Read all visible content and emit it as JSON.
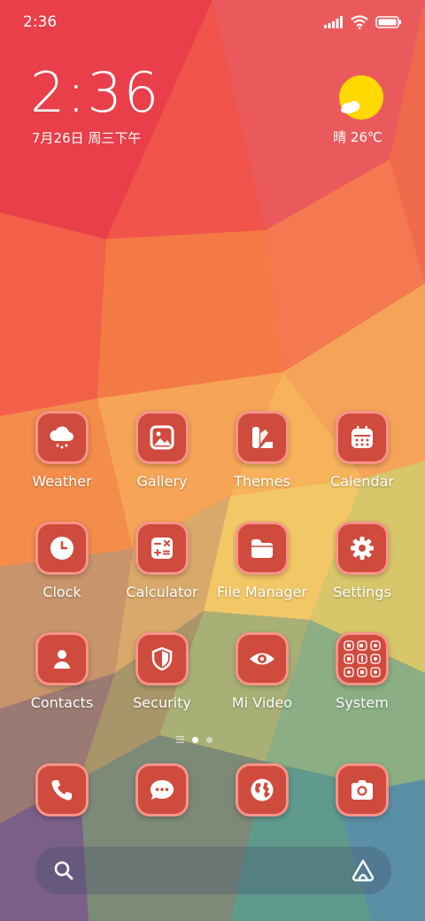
{
  "status_bar": {
    "time": "2:36",
    "icons": [
      "signal-icon",
      "wifi-icon",
      "battery-icon"
    ]
  },
  "clock_widget": {
    "time": "2:36",
    "date": "7月26日 周三下午"
  },
  "weather_widget": {
    "icon": "sun-cloud-icon",
    "text": "晴 26℃"
  },
  "apps": [
    {
      "label": "Weather",
      "icon": "cloud-snow-icon"
    },
    {
      "label": "Gallery",
      "icon": "image-icon"
    },
    {
      "label": "Themes",
      "icon": "palette-icon"
    },
    {
      "label": "Calendar",
      "icon": "calendar-icon"
    },
    {
      "label": "Clock",
      "icon": "clock-icon"
    },
    {
      "label": "Calculator",
      "icon": "calculator-icon"
    },
    {
      "label": "File Manager",
      "icon": "folder-icon"
    },
    {
      "label": "Settings",
      "icon": "gear-icon"
    },
    {
      "label": "Contacts",
      "icon": "person-icon"
    },
    {
      "label": "Security",
      "icon": "shield-icon"
    },
    {
      "label": "Mi Video",
      "icon": "eye-icon"
    },
    {
      "label": "System",
      "icon": "folder-grid-icon"
    }
  ],
  "page_indicator": {
    "pages": 2,
    "current": 1
  },
  "dock": [
    {
      "icon": "phone-icon"
    },
    {
      "icon": "message-icon"
    },
    {
      "icon": "browser-globe-icon"
    },
    {
      "icon": "camera-icon"
    }
  ],
  "search": {
    "icon": "search-icon",
    "assistant_icon": "assistant-icon"
  },
  "colors": {
    "icon_bg": "#cf4b3e",
    "icon_border": "#ff9f96",
    "sun": "#ffd900"
  }
}
